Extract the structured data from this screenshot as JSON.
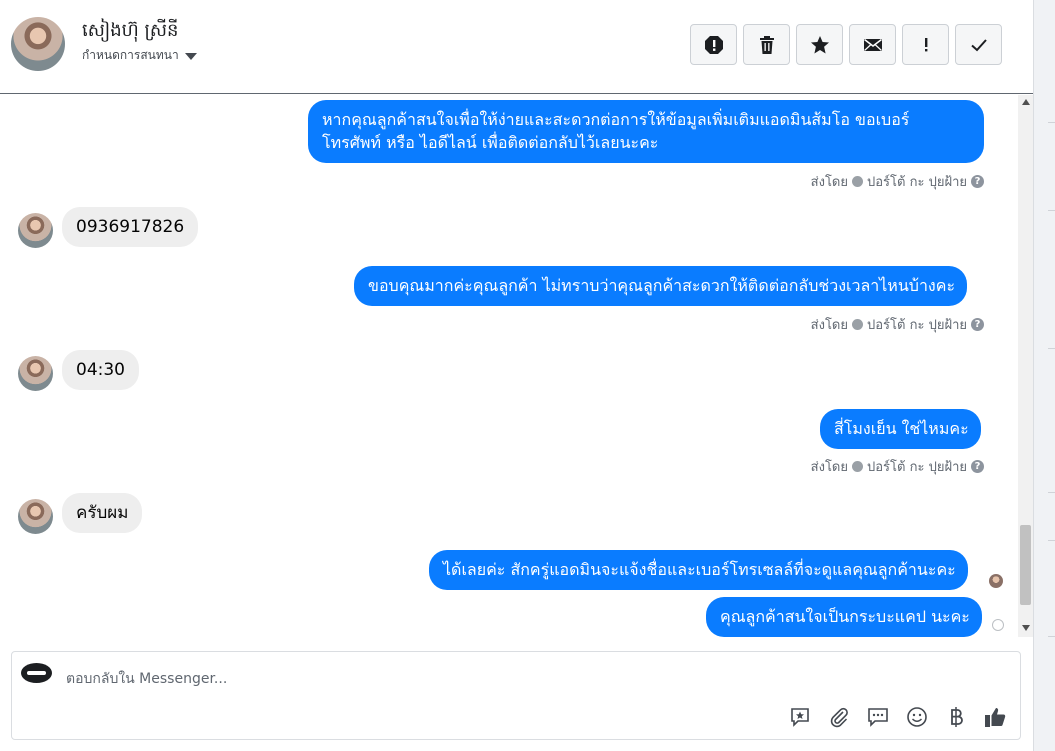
{
  "header": {
    "contact_name": "សៀងហ៊ុ ស្រីនី",
    "assign_label": "กำหนดการสนทนา",
    "actions": [
      "spam-icon",
      "trash-icon",
      "star-icon",
      "envelope-icon",
      "exclamation-icon",
      "check-icon"
    ]
  },
  "messages": {
    "m1": {
      "line1": "หากคุณลูกค้าสนใจเพื่อให้ง่ายและสะดวกต่อการให้ข้อมูลเพิ่มเติมแอดมินส้มโอ ขอเบอร์",
      "line2": "โทรศัพท์ หรือ ไอดีไลน์ เพื่อติดต่อกลับไว้เลยนะคะ"
    },
    "m2": "0936917826",
    "m3": "ขอบคุณมากค่ะคุณลูกค้า ไม่ทราบว่าคุณลูกค้าสะดวกให้ติดต่อกลับช่วงเวลาไหนบ้างคะ",
    "m4": "04:30",
    "m5": "สี่โมงเย็น ใช่ไหมคะ",
    "m6": "ครับผม",
    "m7": "ได้เลยค่ะ สักครู่แอดมินจะแจ้งชื่อและเบอร์โทรเซลล์ที่จะดูแลคุณลูกค้านะคะ",
    "m8": "คุณลูกค้าสนใจเป็นกระบะแคป นะคะ"
  },
  "sent_by": {
    "label": "ส่งโดย",
    "agent": "ปอร์โต้ กะ ปุยฝ้าย"
  },
  "composer": {
    "placeholder": "ตอบกลับใน Messenger...",
    "tools": [
      "saved-reply-icon",
      "attachment-icon",
      "message-icon",
      "emoji-icon",
      "baht-icon",
      "like-icon"
    ]
  },
  "colors": {
    "outgoing_bubble": "#0a7cff",
    "incoming_bubble": "#eeeeee"
  }
}
